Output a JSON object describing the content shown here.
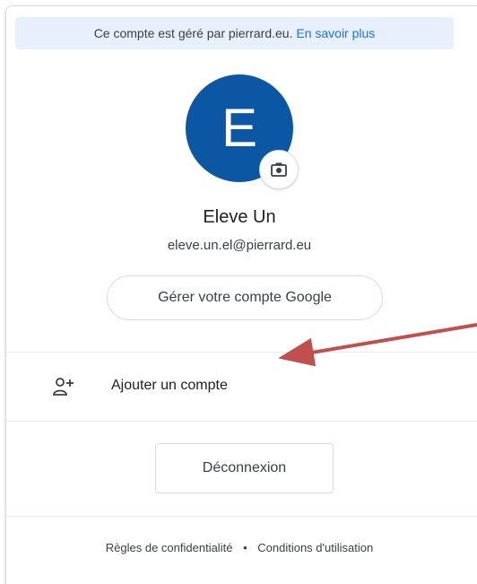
{
  "banner": {
    "text": "Ce compte est géré par pierrard.eu.",
    "link": "En savoir plus"
  },
  "profile": {
    "initial": "E",
    "name": "Eleve Un",
    "email": "eleve.un.el@pierrard.eu",
    "avatar_color": "#0b57a3",
    "camera_icon": "camera-icon"
  },
  "actions": {
    "manage_label": "Gérer votre compte Google",
    "add_account_label": "Ajouter un compte",
    "add_account_icon": "person-add-icon",
    "signout_label": "Déconnexion"
  },
  "footer": {
    "privacy": "Règles de confidentialité",
    "separator": "•",
    "terms": "Conditions d'utilisation"
  },
  "annotation": {
    "arrow_color": "#c0504d"
  }
}
